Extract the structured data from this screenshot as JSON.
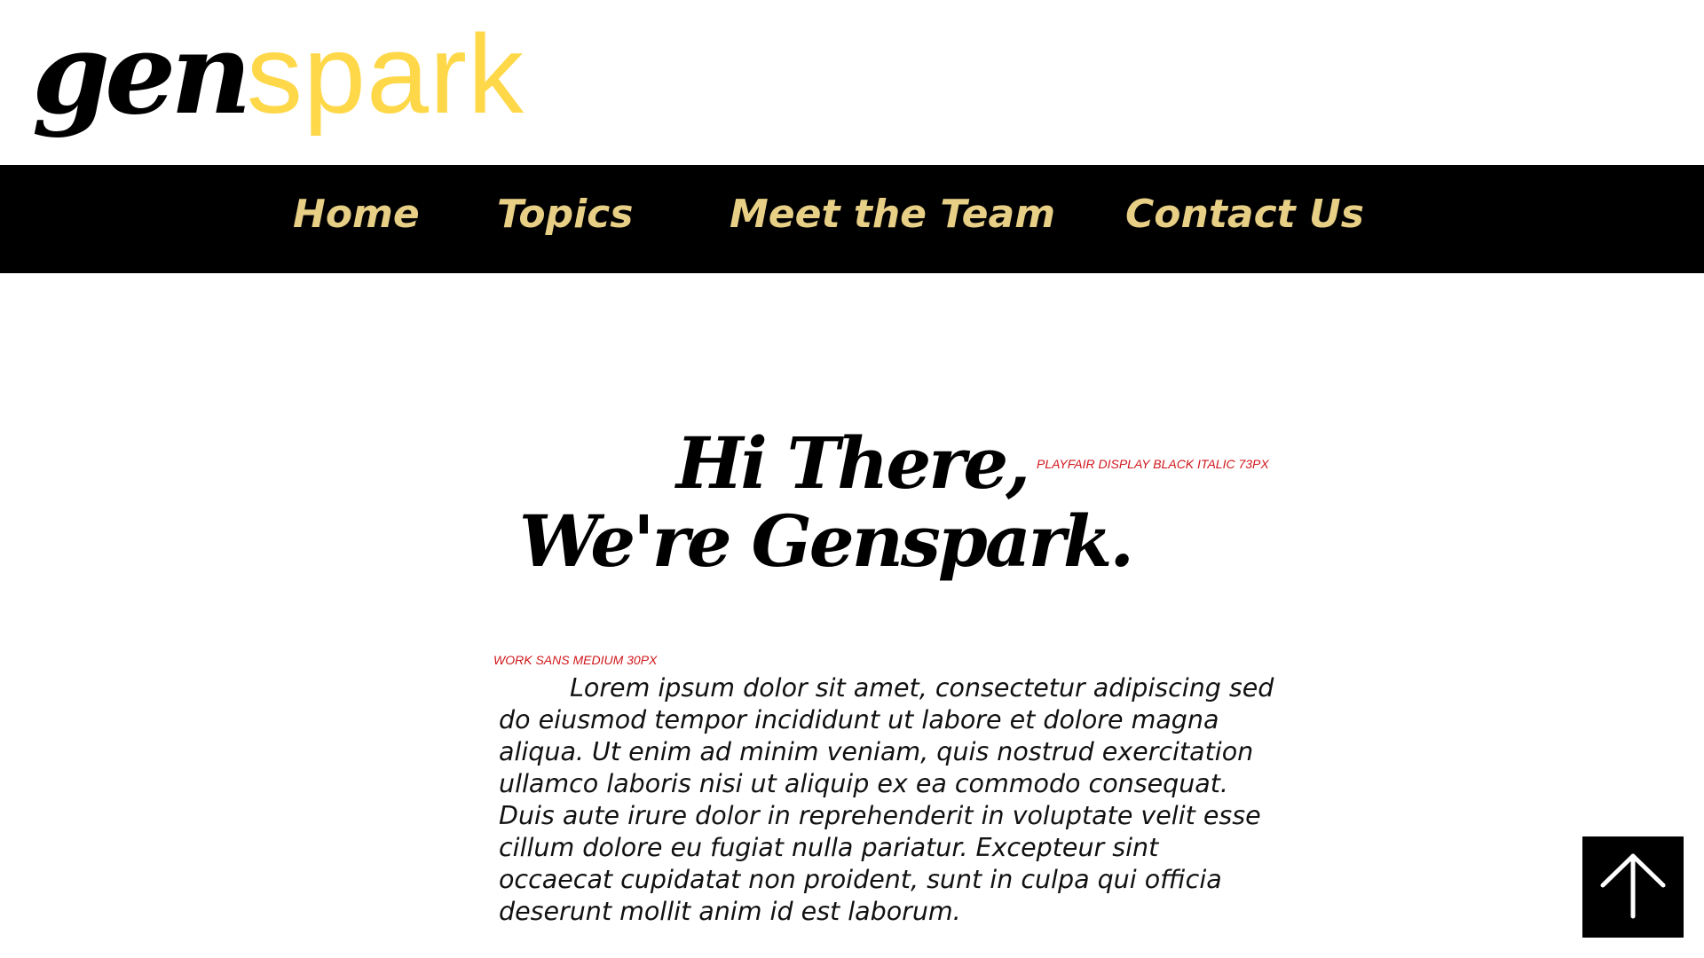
{
  "logo": {
    "part1": "gen",
    "part2": "spark",
    "colors": {
      "part1": "#000000",
      "part2": "#ffd84a"
    }
  },
  "nav": {
    "items": [
      {
        "label": "Home"
      },
      {
        "label": "Topics"
      },
      {
        "label": "Meet the Team"
      },
      {
        "label": "Contact Us"
      }
    ],
    "background": "#000000",
    "text_color": "#e7cf86"
  },
  "hero": {
    "line1": "Hi There,",
    "line2": "We're Genspark.",
    "annotation": "PLAYFAIR DISPLAY BLACK ITALIC 73PX"
  },
  "body": {
    "annotation": "WORK SANS MEDIUM 30PX",
    "paragraph": "Lorem ipsum dolor sit amet, consectetur adipiscing sed do eiusmod tempor incididunt ut labore et dolore magna aliqua. Ut enim ad minim veniam, quis nostrud exercitation ullamco laboris nisi ut aliquip ex ea commodo consequat. Duis aute irure dolor in reprehenderit in voluptate velit esse cillum dolore eu fugiat nulla pariatur. Excepteur sint occaecat cupidatat non proident, sunt in culpa qui officia deserunt mollit anim id est laborum."
  },
  "back_to_top": {
    "icon": "arrow-up-icon"
  },
  "colors": {
    "annotation": "#d0171c",
    "accent": "#ffd84a"
  }
}
